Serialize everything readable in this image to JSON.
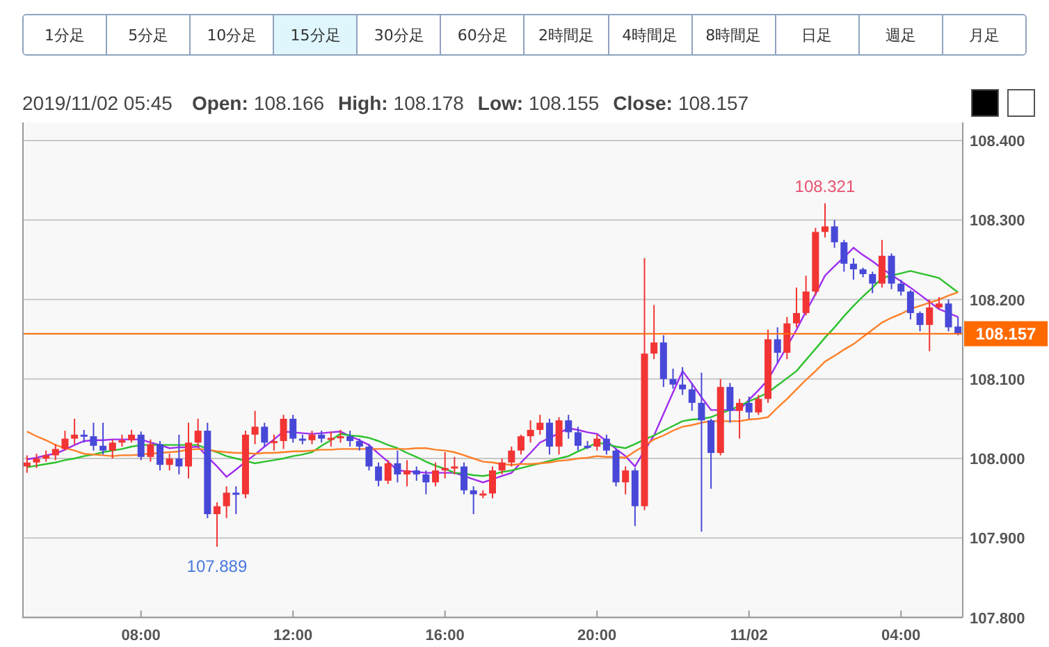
{
  "timeframes": [
    {
      "label": "1分足",
      "selected": false
    },
    {
      "label": "5分足",
      "selected": false
    },
    {
      "label": "10分足",
      "selected": false
    },
    {
      "label": "15分足",
      "selected": true
    },
    {
      "label": "30分足",
      "selected": false
    },
    {
      "label": "60分足",
      "selected": false
    },
    {
      "label": "2時間足",
      "selected": false
    },
    {
      "label": "4時間足",
      "selected": false
    },
    {
      "label": "8時間足",
      "selected": false
    },
    {
      "label": "日足",
      "selected": false
    },
    {
      "label": "週足",
      "selected": false
    },
    {
      "label": "月足",
      "selected": false
    }
  ],
  "ohlc_info": {
    "datetime": "2019/11/02 05:45",
    "fields": [
      {
        "label": "Open:",
        "value": "108.166"
      },
      {
        "label": "High:",
        "value": "108.178"
      },
      {
        "label": "Low:",
        "value": "108.155"
      },
      {
        "label": "Close:",
        "value": "108.157"
      }
    ]
  },
  "color_buttons": [
    {
      "color": "#000000"
    },
    {
      "color": "#ffffff"
    }
  ],
  "chart": {
    "chart_data": {
      "type": "candlestick",
      "grid": true,
      "ylim": [
        107.8,
        108.4
      ],
      "categories": [
        null,
        null,
        null,
        null,
        null,
        null,
        null,
        null,
        null,
        null,
        null,
        null,
        "08:00",
        null,
        null,
        null,
        null,
        null,
        null,
        null,
        null,
        null,
        null,
        null,
        null,
        null,
        null,
        null,
        "12:00",
        null,
        null,
        null,
        null,
        null,
        null,
        null,
        null,
        null,
        null,
        null,
        null,
        null,
        null,
        null,
        "16:00",
        null,
        null,
        null,
        null,
        null,
        null,
        null,
        null,
        null,
        null,
        null,
        null,
        null,
        null,
        null,
        "20:00",
        null,
        null,
        null,
        null,
        null,
        null,
        null,
        null,
        null,
        null,
        null,
        null,
        null,
        null,
        null,
        "11/02",
        null,
        null,
        null,
        null,
        null,
        null,
        null,
        null,
        null,
        null,
        null,
        null,
        null,
        null,
        null,
        "04:00",
        null,
        null,
        null,
        null,
        null,
        null
      ],
      "yticks": [
        {
          "value": 107.8,
          "label": "107.800"
        },
        {
          "value": 107.9,
          "label": "107.900"
        },
        {
          "value": 108.0,
          "label": "108.000"
        },
        {
          "value": 108.1,
          "label": "108.100"
        },
        {
          "value": 108.2,
          "label": "108.200"
        },
        {
          "value": 108.3,
          "label": "108.300"
        },
        {
          "value": 108.4,
          "label": "108.400"
        }
      ],
      "ohlc": [
        [
          107.99,
          108.004,
          107.982,
          107.995
        ],
        [
          107.995,
          108.006,
          107.988,
          108.0
        ],
        [
          108.0,
          108.01,
          107.996,
          108.004
        ],
        [
          108.004,
          108.018,
          107.998,
          108.012
        ],
        [
          108.012,
          108.035,
          108.01,
          108.025
        ],
        [
          108.025,
          108.05,
          108.018,
          108.03
        ],
        [
          108.03,
          108.036,
          108.02,
          108.028
        ],
        [
          108.028,
          108.045,
          108.01,
          108.016
        ],
        [
          108.016,
          108.045,
          108.005,
          108.01
        ],
        [
          108.01,
          108.024,
          108.0,
          108.02
        ],
        [
          108.02,
          108.03,
          108.015,
          108.023
        ],
        [
          108.023,
          108.036,
          108.02,
          108.03
        ],
        [
          108.03,
          108.034,
          107.998,
          108.002
        ],
        [
          108.002,
          108.024,
          107.996,
          108.018
        ],
        [
          108.018,
          108.022,
          107.985,
          107.992
        ],
        [
          107.992,
          108.006,
          107.985,
          108.0
        ],
        [
          108.0,
          108.03,
          107.98,
          107.99
        ],
        [
          107.99,
          108.045,
          107.975,
          108.02
        ],
        [
          108.02,
          108.05,
          108.015,
          108.035
        ],
        [
          108.035,
          108.045,
          107.925,
          107.93
        ],
        [
          107.93,
          107.945,
          107.889,
          107.94
        ],
        [
          107.94,
          107.965,
          107.925,
          107.957
        ],
        [
          107.957,
          107.965,
          107.93,
          107.955
        ],
        [
          107.955,
          108.035,
          107.95,
          108.03
        ],
        [
          108.03,
          108.06,
          108.018,
          108.04
        ],
        [
          108.04,
          108.045,
          108.015,
          108.02
        ],
        [
          108.02,
          108.03,
          108.01,
          108.022
        ],
        [
          108.022,
          108.055,
          108.012,
          108.05
        ],
        [
          108.05,
          108.055,
          108.02,
          108.025
        ],
        [
          108.025,
          108.03,
          108.018,
          108.023
        ],
        [
          108.023,
          108.035,
          108.018,
          108.03
        ],
        [
          108.03,
          108.035,
          108.02,
          108.025
        ],
        [
          108.025,
          108.034,
          108.015,
          108.026
        ],
        [
          108.026,
          108.036,
          108.02,
          108.028
        ],
        [
          108.028,
          108.035,
          108.015,
          108.022
        ],
        [
          108.022,
          108.025,
          108.01,
          108.015
        ],
        [
          108.015,
          108.018,
          107.985,
          107.99
        ],
        [
          107.99,
          107.995,
          107.965,
          107.972
        ],
        [
          107.972,
          107.998,
          107.968,
          107.994
        ],
        [
          107.994,
          108.01,
          107.97,
          107.98
        ],
        [
          107.98,
          107.998,
          107.965,
          107.985
        ],
        [
          107.985,
          107.99,
          107.972,
          107.98
        ],
        [
          107.98,
          107.985,
          107.955,
          107.97
        ],
        [
          107.97,
          107.995,
          107.965,
          107.985
        ],
        [
          107.985,
          108.008,
          107.975,
          107.988
        ],
        [
          107.988,
          108.002,
          107.98,
          107.99
        ],
        [
          107.99,
          107.995,
          107.955,
          107.96
        ],
        [
          107.96,
          107.965,
          107.93,
          107.955
        ],
        [
          107.955,
          107.96,
          107.95,
          107.956
        ],
        [
          107.956,
          107.99,
          107.95,
          107.985
        ],
        [
          107.985,
          108.0,
          107.98,
          107.995
        ],
        [
          107.995,
          108.015,
          107.99,
          108.01
        ],
        [
          108.01,
          108.03,
          108.005,
          108.028
        ],
        [
          108.028,
          108.048,
          108.02,
          108.036
        ],
        [
          108.036,
          108.055,
          108.03,
          108.045
        ],
        [
          108.045,
          108.05,
          108.005,
          108.015
        ],
        [
          108.015,
          108.052,
          108.005,
          108.048
        ],
        [
          108.048,
          108.055,
          108.025,
          108.033
        ],
        [
          108.033,
          108.04,
          108.01,
          108.016
        ],
        [
          108.016,
          108.022,
          108.012,
          108.015
        ],
        [
          108.015,
          108.03,
          108.01,
          108.025
        ],
        [
          108.025,
          108.03,
          108.005,
          108.01
        ],
        [
          108.01,
          108.012,
          107.965,
          107.97
        ],
        [
          107.97,
          107.99,
          107.955,
          107.985
        ],
        [
          107.985,
          107.988,
          107.915,
          107.94
        ],
        [
          107.94,
          108.252,
          107.935,
          108.132
        ],
        [
          108.132,
          108.193,
          108.125,
          108.146
        ],
        [
          108.146,
          108.155,
          108.09,
          108.1
        ],
        [
          108.1,
          108.113,
          108.088,
          108.093
        ],
        [
          108.093,
          108.115,
          108.08,
          108.087
        ],
        [
          108.087,
          108.095,
          108.06,
          108.07
        ],
        [
          108.07,
          108.108,
          107.908,
          108.048
        ],
        [
          108.048,
          108.05,
          107.962,
          108.007
        ],
        [
          108.007,
          108.1,
          108.004,
          108.09
        ],
        [
          108.09,
          108.095,
          108.045,
          108.06
        ],
        [
          108.06,
          108.075,
          108.025,
          108.07
        ],
        [
          108.07,
          108.078,
          108.05,
          108.058
        ],
        [
          108.058,
          108.08,
          108.055,
          108.075
        ],
        [
          108.075,
          108.162,
          108.07,
          108.15
        ],
        [
          108.15,
          108.165,
          108.12,
          108.133
        ],
        [
          108.133,
          108.178,
          108.125,
          108.17
        ],
        [
          108.17,
          108.215,
          108.165,
          108.183
        ],
        [
          108.183,
          108.23,
          108.18,
          108.21
        ],
        [
          108.21,
          108.29,
          108.205,
          108.285
        ],
        [
          108.285,
          108.321,
          108.278,
          108.292
        ],
        [
          108.292,
          108.3,
          108.265,
          108.272
        ],
        [
          108.272,
          108.275,
          108.235,
          108.245
        ],
        [
          108.245,
          108.252,
          108.225,
          108.238
        ],
        [
          108.238,
          108.24,
          108.228,
          108.232
        ],
        [
          108.232,
          108.235,
          108.208,
          108.22
        ],
        [
          108.22,
          108.275,
          108.215,
          108.255
        ],
        [
          108.255,
          108.258,
          108.213,
          108.22
        ],
        [
          108.22,
          108.225,
          108.205,
          108.21
        ],
        [
          108.21,
          108.212,
          108.175,
          108.183
        ],
        [
          108.183,
          108.185,
          108.16,
          108.168
        ],
        [
          108.168,
          108.2,
          108.135,
          108.19
        ],
        [
          108.19,
          108.203,
          108.188,
          108.195
        ],
        [
          108.195,
          108.2,
          108.16,
          108.165
        ],
        [
          108.166,
          108.178,
          108.155,
          108.157
        ]
      ],
      "series": [
        {
          "type": "line",
          "color": "#a02cf0",
          "values": [
            107.999,
            108.001,
            108.004,
            108.006,
            108.011,
            108.017,
            108.022,
            108.023,
            108.023,
            108.024,
            108.024,
            108.024,
            108.024,
            108.02,
            108.017,
            108.013,
            108.014,
            108.014,
            108.015,
            108.002,
            107.99,
            107.977,
            107.986,
            107.996,
            108.005,
            108.015,
            108.024,
            108.034,
            108.033,
            108.032,
            108.031,
            108.032,
            108.033,
            108.034,
            108.028,
            108.023,
            108.017,
            108.006,
            107.996,
            107.985,
            107.984,
            107.983,
            107.982,
            107.982,
            107.982,
            107.982,
            107.978,
            107.974,
            107.97,
            107.974,
            107.978,
            107.982,
            107.995,
            108.007,
            108.02,
            108.026,
            108.032,
            108.038,
            108.036,
            108.033,
            108.031,
            108.022,
            108.012,
            108.003,
            107.99,
            108.01,
            108.029,
            108.056,
            108.083,
            108.11,
            108.094,
            108.077,
            108.061,
            108.061,
            108.061,
            108.061,
            108.074,
            108.086,
            108.099,
            108.12,
            108.141,
            108.162,
            108.185,
            108.207,
            108.23,
            108.242,
            108.253,
            108.265,
            108.256,
            108.248,
            108.239,
            108.231,
            108.223,
            108.215,
            108.206,
            108.197,
            108.188,
            108.183,
            108.178
          ]
        },
        {
          "type": "line",
          "color": "#2cc12c",
          "values": [
            107.989,
            107.991,
            107.993,
            107.995,
            107.998,
            108.0,
            108.003,
            108.005,
            108.008,
            108.01,
            108.012,
            108.015,
            108.017,
            108.017,
            108.017,
            108.017,
            108.017,
            108.017,
            108.017,
            108.012,
            108.008,
            108.003,
            108.0,
            107.997,
            107.994,
            107.996,
            107.998,
            108.0,
            108.003,
            108.005,
            108.008,
            108.016,
            108.023,
            108.031,
            108.029,
            108.028,
            108.026,
            108.022,
            108.017,
            108.013,
            108.007,
            108.002,
            107.996,
            107.991,
            107.987,
            107.982,
            107.981,
            107.979,
            107.978,
            107.98,
            107.983,
            107.985,
            107.988,
            107.991,
            107.994,
            107.997,
            108.0,
            108.003,
            108.009,
            108.014,
            108.02,
            108.018,
            108.015,
            108.013,
            108.018,
            108.024,
            108.029,
            108.035,
            108.041,
            108.047,
            108.049,
            108.05,
            108.052,
            108.057,
            108.061,
            108.066,
            108.072,
            108.077,
            108.083,
            108.092,
            108.101,
            108.11,
            108.124,
            108.138,
            108.152,
            108.165,
            108.179,
            108.192,
            108.204,
            108.215,
            108.227,
            108.23,
            108.233,
            108.236,
            108.233,
            108.23,
            108.227,
            108.218,
            108.209
          ]
        },
        {
          "type": "line",
          "color": "#ff7f27",
          "values": [
            108.034,
            108.028,
            108.023,
            108.017,
            108.013,
            108.01,
            108.006,
            108.005,
            108.004,
            108.003,
            108.004,
            108.004,
            108.005,
            108.006,
            108.007,
            108.008,
            108.009,
            108.011,
            108.012,
            108.011,
            108.009,
            108.008,
            108.007,
            108.007,
            108.006,
            108.007,
            108.007,
            108.008,
            108.009,
            108.009,
            108.01,
            108.011,
            108.011,
            108.012,
            108.012,
            108.012,
            108.012,
            108.012,
            108.012,
            108.012,
            108.012,
            108.013,
            108.013,
            108.011,
            108.01,
            108.008,
            108.004,
            108.0,
            107.996,
            107.995,
            107.993,
            107.992,
            107.993,
            107.993,
            107.994,
            107.995,
            107.997,
            107.998,
            108.0,
            108.001,
            108.003,
            108.002,
            108.002,
            108.001,
            108.009,
            108.016,
            108.024,
            108.029,
            108.035,
            108.04,
            108.042,
            108.045,
            108.047,
            108.047,
            108.047,
            108.047,
            108.049,
            108.05,
            108.052,
            108.064,
            108.075,
            108.087,
            108.099,
            108.11,
            108.122,
            108.129,
            108.137,
            108.144,
            108.153,
            108.162,
            108.171,
            108.177,
            108.182,
            108.188,
            108.192,
            108.196,
            108.2,
            108.205,
            108.209
          ]
        }
      ],
      "ref_lines": [
        {
          "axis": "y",
          "value": 108.157,
          "label": "108.157",
          "color": "#ff6a00"
        }
      ],
      "annotations": [
        "108.321",
        "107.889"
      ]
    }
  }
}
